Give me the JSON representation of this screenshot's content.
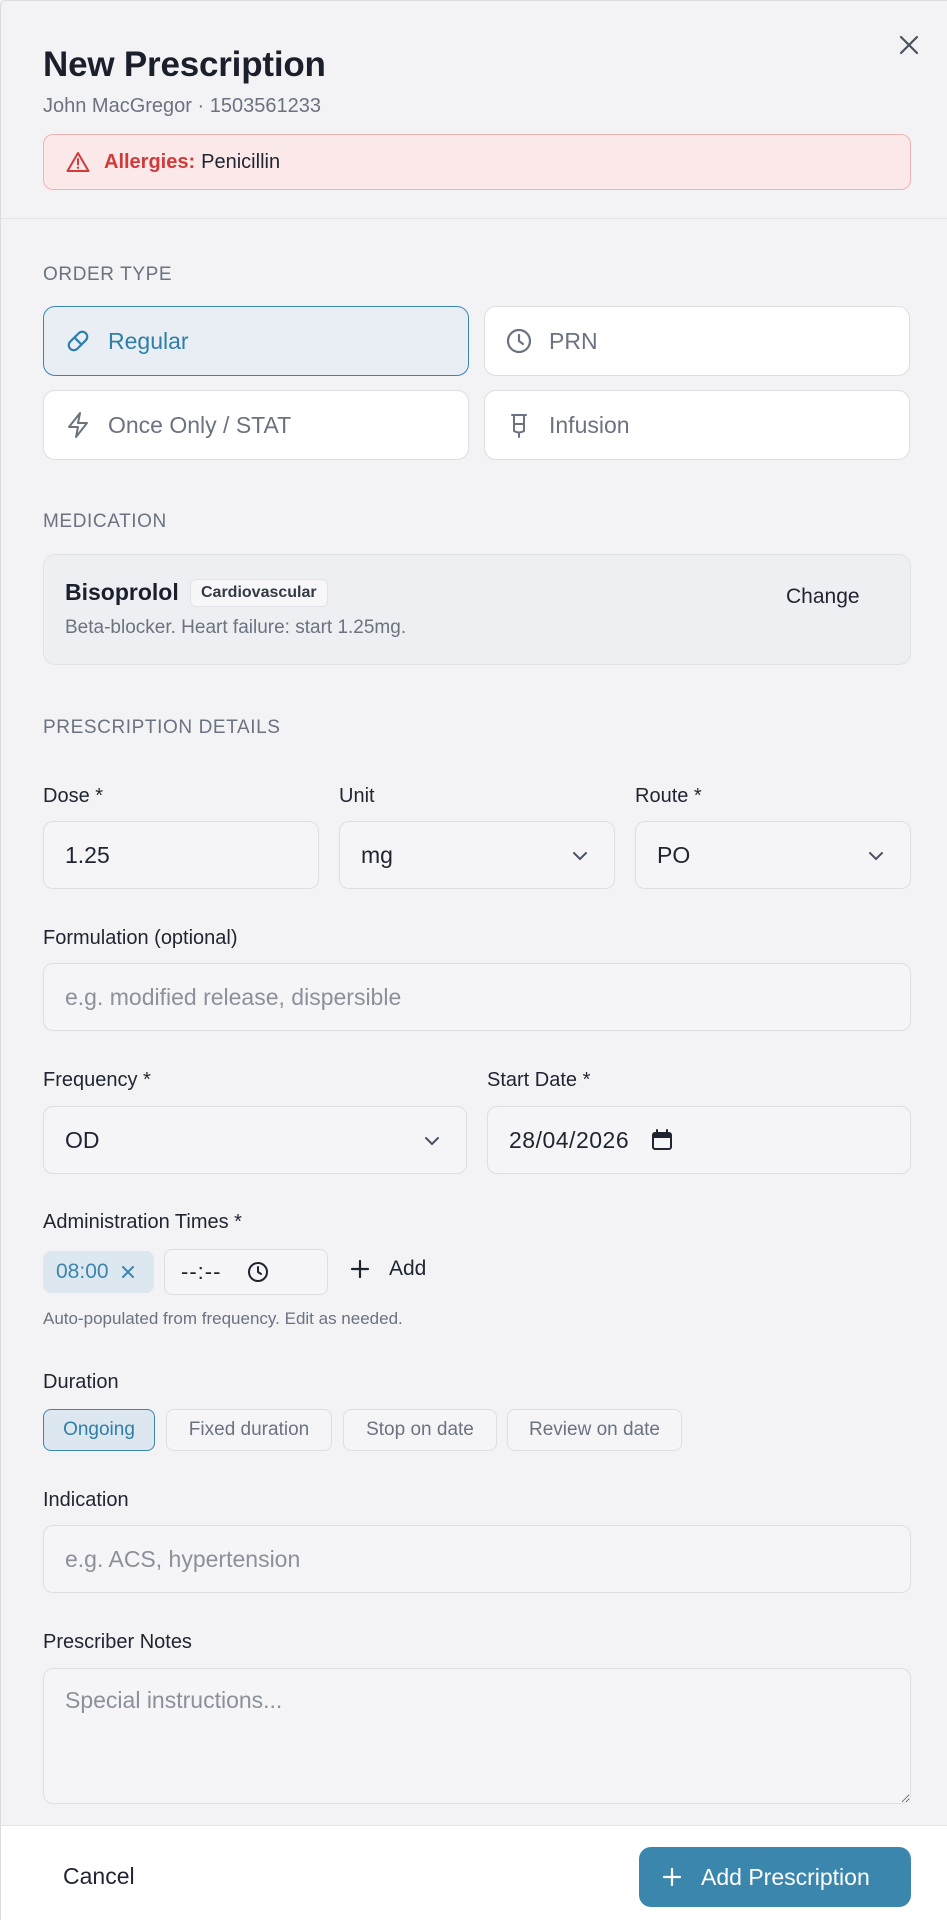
{
  "header": {
    "title": "New Prescription",
    "patient": "John MacGregor · 1503561233",
    "allergy_label": "Allergies:",
    "allergy_value": "Penicillin"
  },
  "order_type": {
    "section": "ORDER TYPE",
    "options": [
      {
        "label": "Regular",
        "icon": "pill-icon",
        "selected": true
      },
      {
        "label": "PRN",
        "icon": "clock-icon",
        "selected": false
      },
      {
        "label": "Once Only / STAT",
        "icon": "lightning-icon",
        "selected": false
      },
      {
        "label": "Infusion",
        "icon": "infusion-bag-icon",
        "selected": false
      }
    ]
  },
  "medication": {
    "section": "MEDICATION",
    "name": "Bisoprolol",
    "tag": "Cardiovascular",
    "description": "Beta-blocker. Heart failure: start 1.25mg.",
    "change_label": "Change"
  },
  "details": {
    "section": "PRESCRIPTION DETAILS",
    "dose_label": "Dose *",
    "dose_value": "1.25",
    "unit_label": "Unit",
    "unit_value": "mg",
    "route_label": "Route *",
    "route_value": "PO",
    "formulation_label": "Formulation (optional)",
    "formulation_placeholder": "e.g. modified release, dispersible",
    "frequency_label": "Frequency *",
    "frequency_value": "OD",
    "start_date_label": "Start Date *",
    "start_date_value": "28/04/2026",
    "admin_times_label": "Administration Times *",
    "admin_times": [
      "08:00"
    ],
    "time_placeholder": "--:--",
    "add_label": "Add",
    "admin_help": "Auto-populated from frequency. Edit as needed.",
    "duration_label": "Duration",
    "duration_options": [
      "Ongoing",
      "Fixed duration",
      "Stop on date",
      "Review on date"
    ],
    "duration_selected": "Ongoing",
    "indication_label": "Indication",
    "indication_placeholder": "e.g. ACS, hypertension",
    "notes_label": "Prescriber Notes",
    "notes_placeholder": "Special instructions..."
  },
  "footer": {
    "cancel_label": "Cancel",
    "submit_label": "Add Prescription"
  },
  "colors": {
    "accent": "#3b86ad",
    "danger": "#d23a3a",
    "background": "#f3f3f5"
  }
}
